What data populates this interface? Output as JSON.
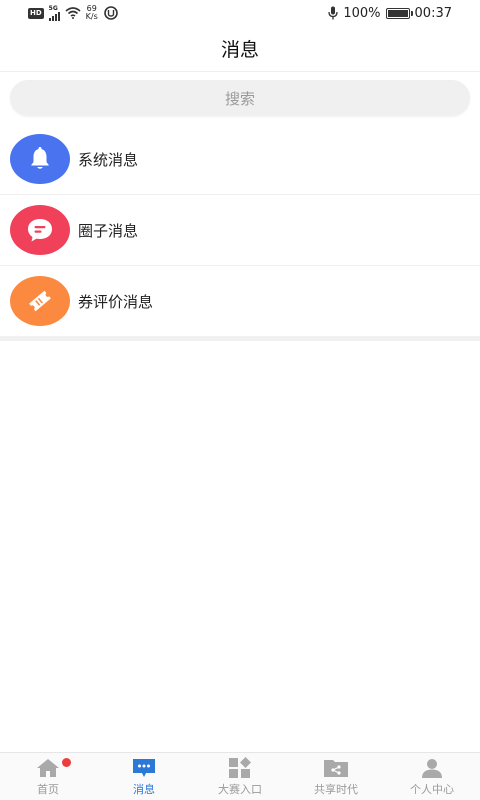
{
  "status_bar": {
    "hd": "HD",
    "network": "5G",
    "speed_value": "69",
    "speed_unit": "K/s",
    "battery_percent": "100%",
    "time": "00:37"
  },
  "header": {
    "title": "消息"
  },
  "search": {
    "placeholder": "搜索"
  },
  "messages": [
    {
      "label": "系统消息",
      "icon": "bell-icon",
      "color": "#4a73f0"
    },
    {
      "label": "圈子消息",
      "icon": "chat-bubble-icon",
      "color": "#f0405a"
    },
    {
      "label": "券评价消息",
      "icon": "ticket-icon",
      "color": "#fb8a40"
    }
  ],
  "tabs": [
    {
      "label": "首页",
      "icon": "home-icon",
      "badge": true
    },
    {
      "label": "消息",
      "icon": "message-icon",
      "active": true
    },
    {
      "label": "大赛入口",
      "icon": "grid-icon"
    },
    {
      "label": "共享时代",
      "icon": "share-folder-icon"
    },
    {
      "label": "个人中心",
      "icon": "person-icon"
    }
  ],
  "colors": {
    "active_tab": "#2b78d6",
    "inactive_tab": "#9a9a9a",
    "badge": "#ee3b3b"
  }
}
